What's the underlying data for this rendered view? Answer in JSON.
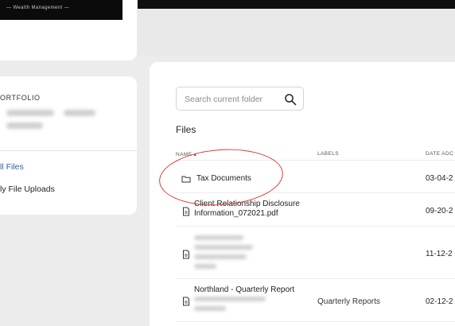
{
  "brand": {
    "tagline": "— Wealth Management —"
  },
  "sidebar": {
    "section_label": "ORTFOLIO",
    "nav": [
      {
        "label": "ll Files",
        "active": true
      },
      {
        "label": "ly File Uploads",
        "active": false
      }
    ]
  },
  "search": {
    "placeholder": "Search current folder",
    "icon": "search-icon"
  },
  "files": {
    "title": "Files",
    "columns": {
      "name": "NAME ▴",
      "labels": "LABELS",
      "date": "DATE ADC"
    },
    "rows": [
      {
        "icon": "folder-icon",
        "name": "Tax Documents",
        "labels": "",
        "date": "03-04-2"
      },
      {
        "icon": "document-icon",
        "name": "Client Relationship Disclosure Information_072021.pdf",
        "labels": "",
        "date": "09-20-2"
      },
      {
        "icon": "document-icon",
        "name": "",
        "labels": "",
        "date": "11-12-2"
      },
      {
        "icon": "document-icon",
        "name": "Northland - Quarterly Report",
        "labels": "Quarterly Reports",
        "date": "02-12-2"
      }
    ]
  },
  "colors": {
    "accent": "#2f5fb0",
    "annotation": "#e03a3a",
    "topbar": "#0f0f10",
    "background": "#ececed"
  }
}
